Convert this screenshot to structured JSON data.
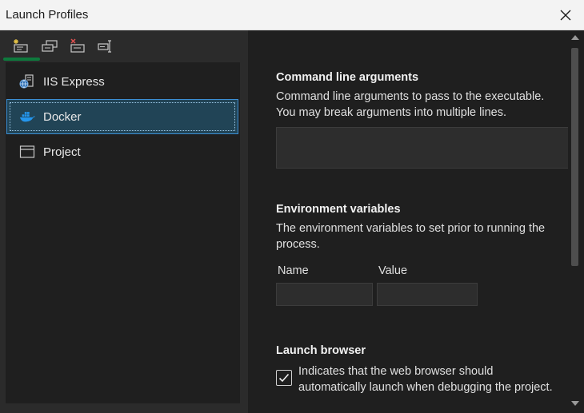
{
  "window": {
    "title": "Launch Profiles"
  },
  "toolbar": {
    "icons": [
      "new-profile-icon",
      "copy-profile-icon",
      "delete-profile-icon",
      "rename-profile-icon"
    ]
  },
  "profiles": [
    {
      "label": "IIS Express",
      "icon": "globe-server-icon",
      "selected": false
    },
    {
      "label": "Docker",
      "icon": "docker-whale-icon",
      "selected": true
    },
    {
      "label": "Project",
      "icon": "window-icon",
      "selected": false
    }
  ],
  "settings": {
    "command_line": {
      "title": "Command line arguments",
      "description_line1": "Command line arguments to pass to the executable.",
      "description_line2": "You may break arguments into multiple lines.",
      "value": ""
    },
    "env": {
      "title": "Environment variables",
      "description_line1": "The environment variables to set prior to running the",
      "description_line2": "process.",
      "name_label": "Name",
      "value_label": "Value",
      "name_value": "",
      "value_value": ""
    },
    "browser": {
      "title": "Launch browser",
      "description_line1": "Indicates that the web browser should",
      "description_line2": "automatically launch when debugging the project.",
      "checked": true
    }
  },
  "colors": {
    "selection_bg": "#214456",
    "selection_border": "#3c8fd4",
    "toolbar_indicator": "#0e7a3d",
    "docker_blue": "#2496ed"
  }
}
